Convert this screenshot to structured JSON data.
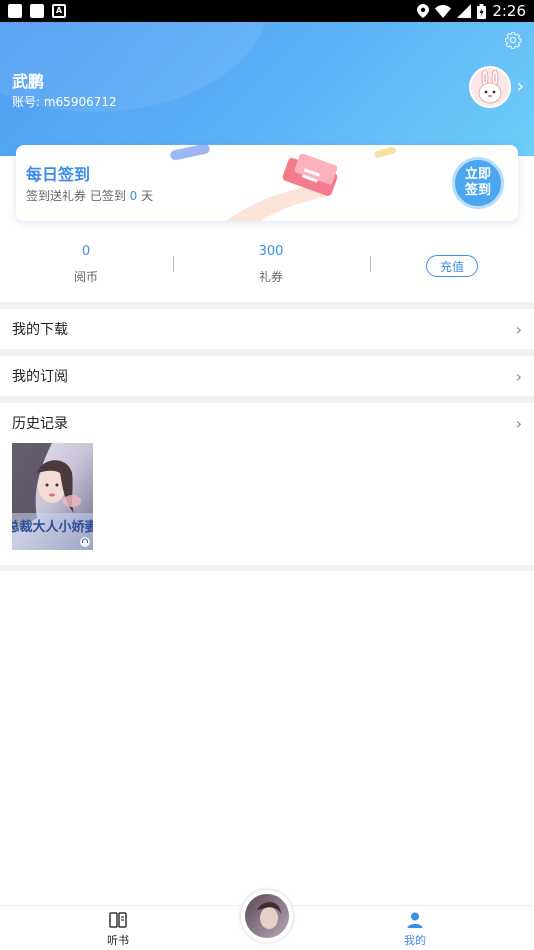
{
  "status_bar": {
    "time": "2:26",
    "notification_a": "A"
  },
  "profile": {
    "name": "武鹏",
    "account": "账号: m65906712"
  },
  "checkin": {
    "title": "每日签到",
    "subtitle_prefix": "签到送礼券 已签到 ",
    "days": "0",
    "days_suffix": " 天",
    "button_line1": "立即",
    "button_line2": "签到"
  },
  "stats": {
    "coins": {
      "value": "0",
      "label": "阅币"
    },
    "vouchers": {
      "value": "300",
      "label": "礼券"
    },
    "recharge_label": "充值"
  },
  "menu": {
    "downloads": "我的下载",
    "subscriptions": "我的订阅",
    "history": "历史记录"
  },
  "history_items": [
    {
      "cover_title": "总裁大人小娇妻"
    }
  ],
  "bottom_nav": {
    "listen": "听书",
    "mine": "我的"
  },
  "colors": {
    "accent": "#3b8ee8",
    "header_start": "#4f9cf3",
    "header_end": "#6fcdf8"
  }
}
